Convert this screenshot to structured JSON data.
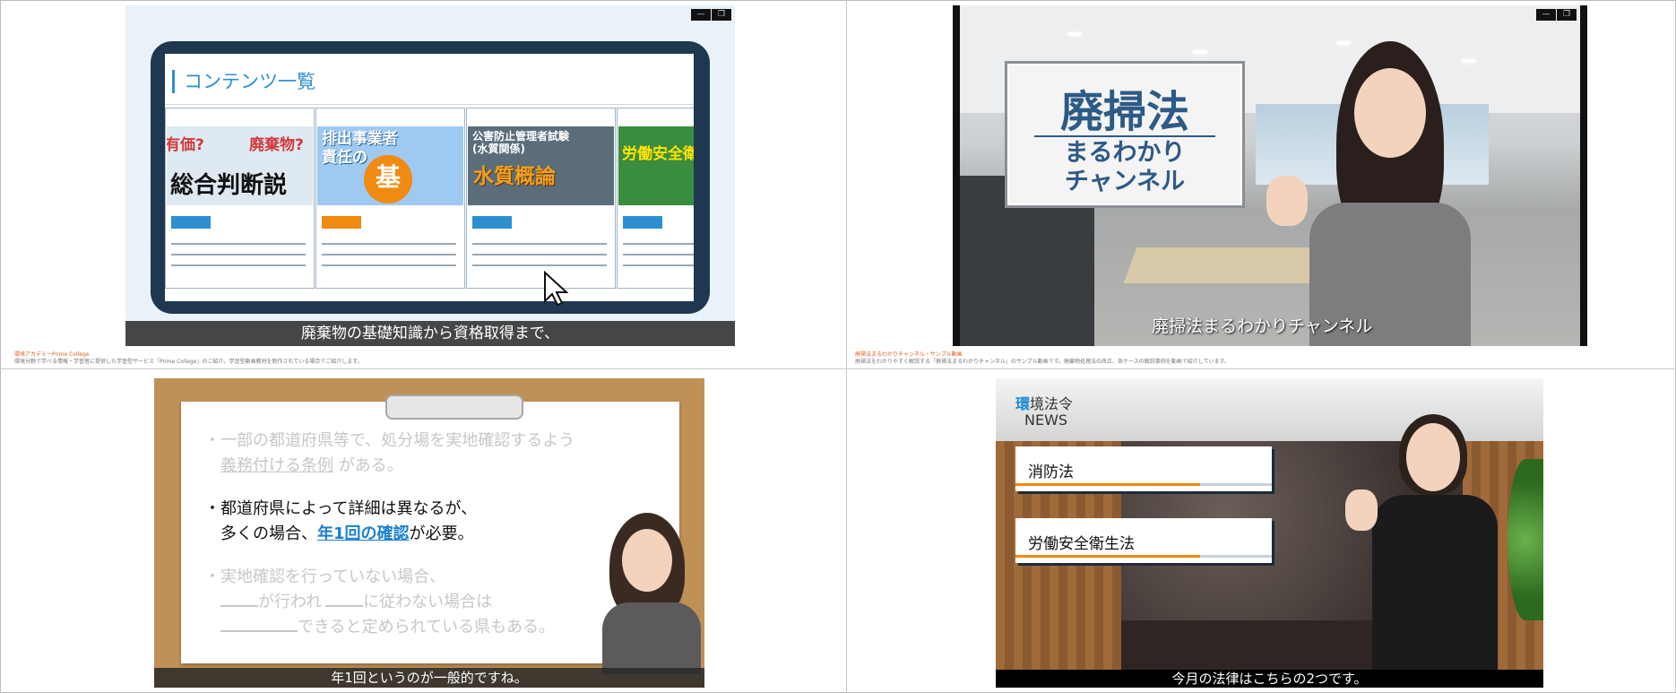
{
  "window_controls": {
    "minimize": "—",
    "maximize": "❐"
  },
  "panels": {
    "q1": {
      "screen_title": "コンテンツ一覧",
      "cards": [
        {
          "top_marks": [
            "有価?",
            "廃棄物?"
          ],
          "headline": "総合判断説",
          "tag_color": "#2e8fd0"
        },
        {
          "headline_lines": [
            "排出事業者",
            "責任の"
          ],
          "badge": "基",
          "tag_color": "#f08a10"
        },
        {
          "subtitle_lines": [
            "公害防止管理者試験",
            "(水質関係)"
          ],
          "headline": "水質概論",
          "tag_color": "#2e8fd0"
        },
        {
          "headline": "労働安全衛",
          "tag_color": "#2e8fd0"
        }
      ],
      "caption": "廃棄物の基礎知識から資格取得まで、",
      "description_title": "環境アカデミーPrime College",
      "description_body": "環境分野で学べる情報・学習者に提供した学習型サービス「Prime College」のご紹介。学習型動画教材を制作されている場合でご紹介します。"
    },
    "q2": {
      "sign_title": "廃掃法",
      "sign_sub_lines": [
        "まるわかり",
        "チャンネル"
      ],
      "caption": "廃掃法まるわかりチャンネル",
      "description_title": "廃掃法まるわかりチャンネル・サンプル動画",
      "description_body": "廃掃法をわかりやすく解説する「廃掃法まるわかりチャンネル」のサンプル動画です。廃棄物処理法の改正、各ケースの解説事例を動画で紹介しています。"
    },
    "q3": {
      "bullet1_line1": "・一部の都道府県等で、処分場を実地確認するよう",
      "bullet1_line2_em": "義務付ける条例",
      "bullet1_line2_rest": "がある。",
      "bullet2_line1": "・都道府県によって詳細は異なるが、",
      "bullet2_line2_pre": "多くの場合、",
      "bullet2_line2_em": "年1回の確認",
      "bullet2_line2_post": "が必要。",
      "bullet3_line1": "・実地確認を行っていない場合、",
      "bullet3_line2_a": "が行われ",
      "bullet3_line2_b": "に従わない場合は",
      "bullet3_line3": "できると定められている県もある。",
      "caption": "年1回というのが一般的ですね。"
    },
    "q4": {
      "logo_accent": "環",
      "logo_rest": "境法令",
      "logo_sub": "NEWS",
      "laws": [
        "消防法",
        "労働安全衛生法"
      ],
      "caption": "今月の法律はこちらの2つです。"
    }
  },
  "icons": {
    "cursor": "mouse-pointer-icon"
  },
  "colors": {
    "accent_blue": "#2e8fd0",
    "accent_orange": "#f08a10",
    "caption_bg": "#333333"
  }
}
